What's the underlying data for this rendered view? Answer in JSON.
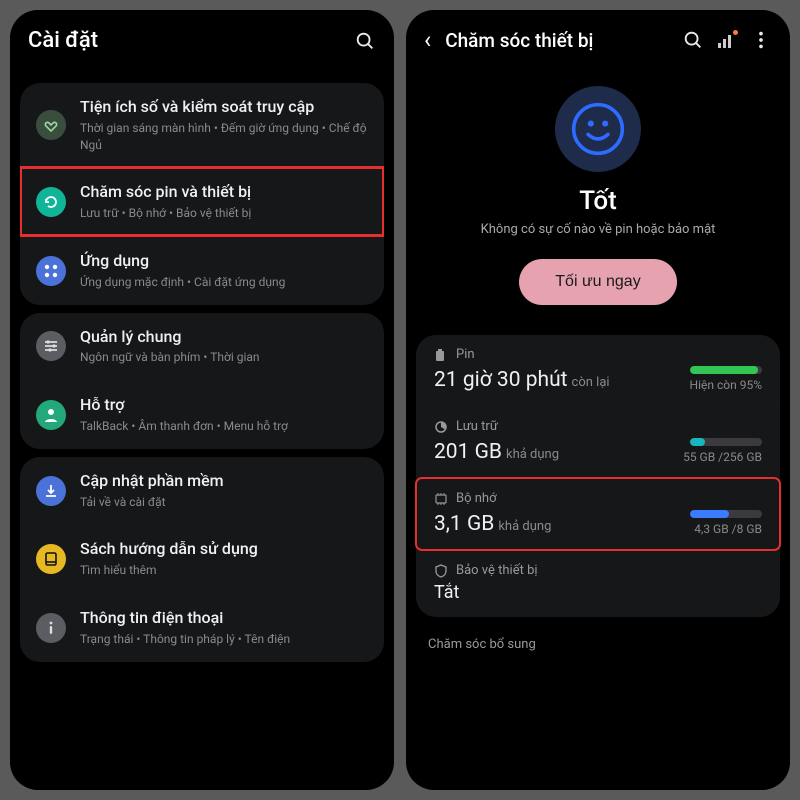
{
  "left": {
    "title": "Cài đặt",
    "clipped_prev": "",
    "groups": [
      {
        "items": [
          {
            "icon": "heart",
            "color": "#3a4e3e",
            "title": "Tiện ích số và kiểm soát truy cập",
            "sub": "Thời gian sáng màn hình  •  Đếm giờ ứng dụng  •  Chế độ Ngủ"
          },
          {
            "icon": "refresh",
            "color": "#10b598",
            "title": "Chăm sóc pin và thiết bị",
            "sub": "Lưu trữ  •  Bộ nhớ  •  Bảo vệ thiết bị",
            "highlight": true
          },
          {
            "icon": "grid",
            "color": "#4a72d8",
            "title": "Ứng dụng",
            "sub": "Ứng dụng mặc định  •  Cài đặt ứng dụng"
          }
        ]
      },
      {
        "items": [
          {
            "icon": "sliders",
            "color": "#5b5d63",
            "title": "Quản lý chung",
            "sub": "Ngôn ngữ và bàn phím  •  Thời gian"
          },
          {
            "icon": "person",
            "color": "#22a87a",
            "title": "Hỗ trợ",
            "sub": "TalkBack  •  Âm thanh đơn  •  Menu hỗ trợ"
          }
        ]
      },
      {
        "items": [
          {
            "icon": "download",
            "color": "#4a72d8",
            "title": "Cập nhật phần mềm",
            "sub": "Tải về và cài đặt"
          },
          {
            "icon": "book",
            "color": "#e6b923",
            "title": "Sách hướng dẫn sử dụng",
            "sub": "Tìm hiểu thêm"
          },
          {
            "icon": "info",
            "color": "#5b5d63",
            "title": "Thông tin điện thoại",
            "sub": "Trạng thái  •  Thông tin pháp lý  •  Tên điện"
          }
        ]
      }
    ]
  },
  "right": {
    "title": "Chăm sóc thiết bị",
    "status_title": "Tốt",
    "status_sub": "Không có sự cố nào về pin hoặc bảo mật",
    "optimize": "Tối ưu ngay",
    "stats": [
      {
        "key": "battery",
        "label": "Pin",
        "value": "21 giờ 30 phút",
        "unit": "còn lại",
        "right_text": "Hiện còn 95%",
        "bar_pct": 95,
        "bar_color": "#31c752"
      },
      {
        "key": "storage",
        "label": "Lưu trữ",
        "value": "201 GB",
        "unit": "khả dụng",
        "right_text": "55 GB /256 GB",
        "bar_pct": 21,
        "bar_color": "#17b7c0"
      },
      {
        "key": "memory",
        "label": "Bộ nhớ",
        "value": "3,1 GB",
        "unit": "khả dụng",
        "right_text": "4,3 GB /8 GB",
        "bar_pct": 54,
        "bar_color": "#3b7bff",
        "highlight": true
      },
      {
        "key": "protect",
        "label": "Bảo vệ thiết bị",
        "value_off": "Tắt"
      }
    ],
    "extra_label": "Chăm sóc bổ sung"
  }
}
